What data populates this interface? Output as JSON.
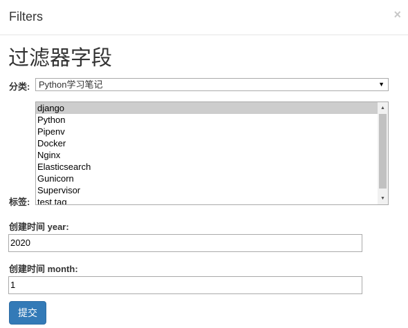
{
  "modal": {
    "title": "Filters",
    "close_glyph": "×"
  },
  "form": {
    "heading": "过滤器字段",
    "category": {
      "label": "分类:",
      "selected": "Python学习笔记",
      "arrow_glyph": "▼"
    },
    "tags": {
      "label": "标签:",
      "options": [
        "django",
        "Python",
        "Pipenv",
        "Docker",
        "Nginx",
        "Elasticsearch",
        "Gunicorn",
        "Supervisor",
        "test tag"
      ],
      "selected": [
        "django"
      ],
      "scroll_up_glyph": "▲",
      "scroll_down_glyph": "▼"
    },
    "year": {
      "label": "创建时间 year:",
      "value": "2020"
    },
    "month": {
      "label": "创建时间 month:",
      "value": "1"
    },
    "submit_label": "提交"
  },
  "colors": {
    "primary_button": "#337ab7",
    "selected_option": "#cdcdcd"
  }
}
